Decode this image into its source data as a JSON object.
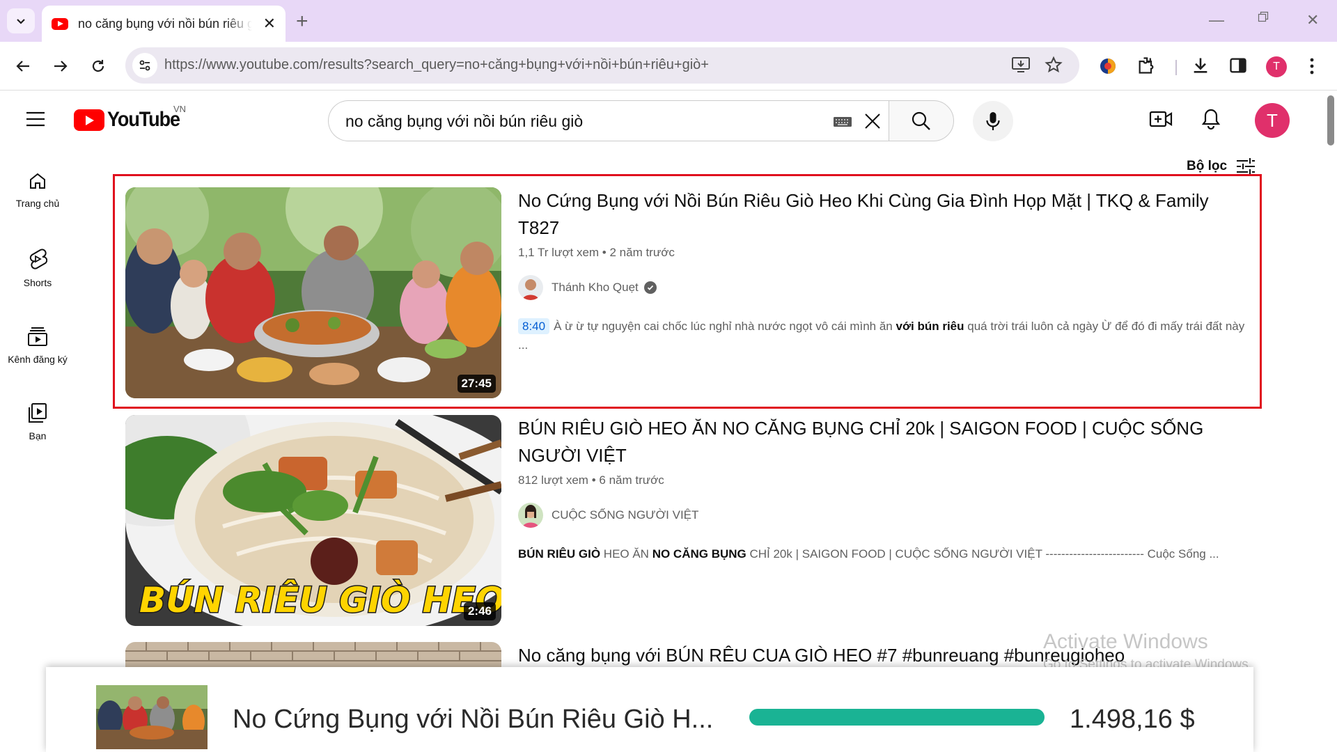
{
  "browser": {
    "tab_title": "no căng bụng với nồi bún riêu giò heo",
    "url": "https://www.youtube.com/results?search_query=no+căng+bụng+với+nồi+bún+riêu+giò+",
    "profile_initial": "T",
    "accent": "#e8d8f7"
  },
  "header": {
    "logo_text": "YouTube",
    "country_code": "VN",
    "search_query": "no căng bụng với nồi bún riêu giò",
    "avatar_initial": "T"
  },
  "sidebar": {
    "items": [
      {
        "label": "Trang chủ",
        "icon": "home-icon"
      },
      {
        "label": "Shorts",
        "icon": "shorts-icon"
      },
      {
        "label": "Kênh đăng ký",
        "icon": "subscriptions-icon"
      },
      {
        "label": "Bạn",
        "icon": "you-icon"
      }
    ]
  },
  "filters": {
    "label": "Bộ lọc"
  },
  "results": [
    {
      "title": "No Cứng Bụng với Nồi Bún Riêu Giò Heo Khi Cùng Gia Đình Họp Mặt | TKQ & Family T827",
      "views": "1,1 Tr lượt xem",
      "age": "2 năm trước",
      "channel": "Thánh Kho Quẹt",
      "duration": "27:45",
      "timestamp": "8:40",
      "snippet_pre": "À ừ ừ tự nguyện cai chốc lúc nghỉ nhà nước ngọt vô cái mình ăn ",
      "snippet_bold": "với bún riêu",
      "snippet_post": " quá trời trái luôn cả ngày Ừ để đó đi mấy trái đất này ..."
    },
    {
      "title": "BÚN RIÊU GIÒ HEO ĂN NO CĂNG BỤNG CHỈ 20k | SAIGON FOOD | CUỘC SỐNG NGƯỜI VIỆT",
      "views": "812 lượt xem",
      "age": "6 năm trước",
      "channel": "CUỘC SỐNG NGƯỜI VIỆT",
      "duration": "2:46",
      "thumb_caption": "BÚN RIÊU GIÒ HEO",
      "snippet_b1": "BÚN RIÊU GIÒ",
      "snippet_t1": " HEO ĂN ",
      "snippet_b2": "NO CĂNG BỤNG",
      "snippet_t2": " CHỈ 20k | SAIGON FOOD | CUỘC SỐNG NGƯỜI VIỆT ------------------------- Cuộc Sống ..."
    },
    {
      "title": "No căng bụng với BÚN RÊU CUA GIÒ HEO #7 #bunreuang #bunreugioheo"
    }
  ],
  "watermark": {
    "line1": "Activate Windows",
    "line2": "Go to Settings to activate Windows."
  },
  "overlay": {
    "title": "No Cứng Bụng với Nồi Bún Riêu Giò H...",
    "progress": 1.0,
    "amount": "1.498,16 $",
    "progress_color": "#1ab394"
  }
}
